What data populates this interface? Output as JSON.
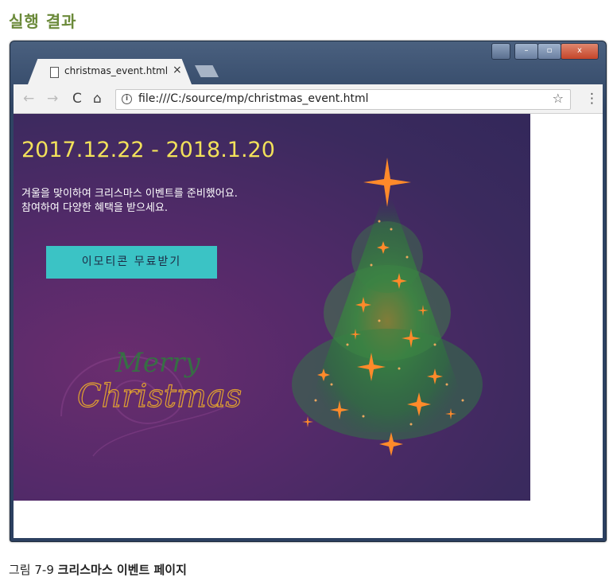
{
  "heading": "실행 결과",
  "browser": {
    "tab_title": "christmas_event.html",
    "tab_close": "×",
    "url": "file:///C:/source/mp/christmas_event.html",
    "nav": {
      "back": "←",
      "forward": "→",
      "reload": "C",
      "home": "⌂",
      "info": "i",
      "star": "☆",
      "menu": "⋮"
    },
    "window_buttons": {
      "minimize": "–",
      "maximize": "▫",
      "close": "x"
    }
  },
  "page": {
    "date_range": "2017.12.22  -  2018.1.20",
    "description_line1": "겨울을 맞이하여 크리스마스 이벤트를 준비했어요.",
    "description_line2": "참여하여 다양한 혜택을 받으세요.",
    "cta_button": "이모티콘 무료받기",
    "merry_text": "Merry",
    "christmas_text": "Christmas"
  },
  "caption": {
    "label": "그림 7-9",
    "title": "크리스마스 이벤트 페이지"
  },
  "colors": {
    "heading": "#6b8a3a",
    "date": "#f2e15a",
    "button": "#3bc3c5",
    "background": "#552a6a",
    "tree_green": "#2f8a45",
    "sparkle": "#ff8a2a"
  }
}
